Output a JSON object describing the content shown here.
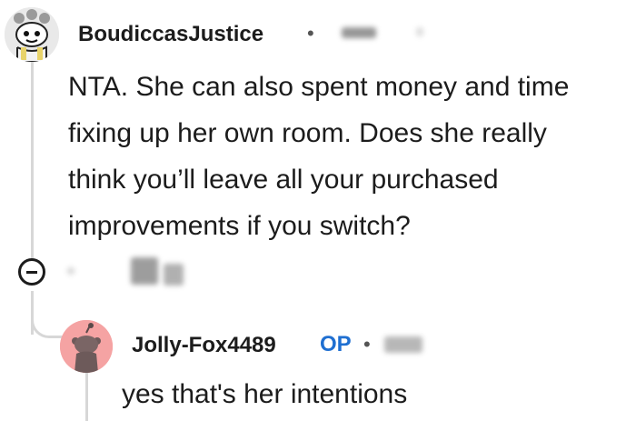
{
  "comment": {
    "username": "BoudiccasJustice",
    "separator": "•",
    "body_lines": [
      "NTA. She can also spent money and time",
      "fixing up her own room. Does she really",
      "think you’ll leave all your purchased",
      "improvements if you switch?"
    ]
  },
  "reply": {
    "username": "Jolly-Fox4489",
    "badge": "OP",
    "separator": "•",
    "body": "yes that's her intentions"
  },
  "icons": {
    "collapse": "minus-circle-icon",
    "avatar_1": "snoo-avatar-icon",
    "avatar_2": "snoo-avatar-icon"
  },
  "colors": {
    "op_badge": "#1f6fd1",
    "thread_line": "#d7d7d7",
    "avatar_2_bg": "#f5a3a3"
  }
}
